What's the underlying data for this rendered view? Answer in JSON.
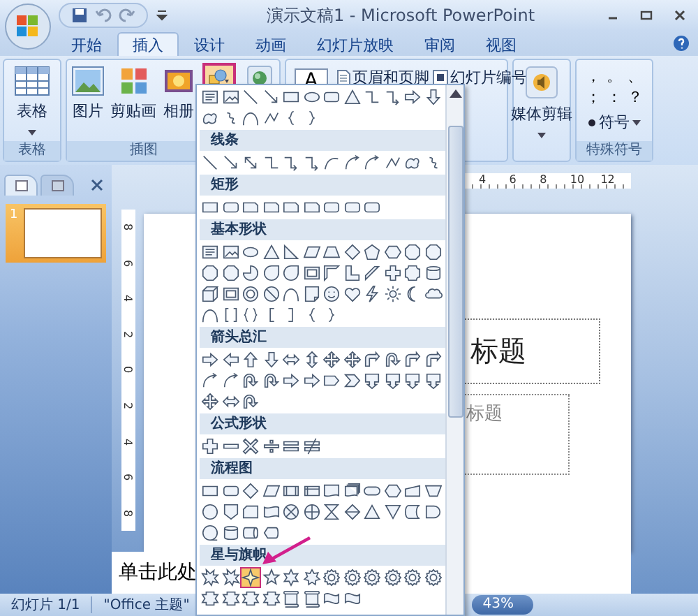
{
  "window": {
    "title": "演示文稿1 - Microsoft PowerPoint"
  },
  "tabs": [
    {
      "label": "开始",
      "selected": false
    },
    {
      "label": "插入",
      "selected": true
    },
    {
      "label": "设计",
      "selected": false
    },
    {
      "label": "动画",
      "selected": false
    },
    {
      "label": "幻灯片放映",
      "selected": false
    },
    {
      "label": "审阅",
      "selected": false
    },
    {
      "label": "视图",
      "selected": false
    }
  ],
  "ribbon": {
    "table_group": {
      "label": "表格",
      "button": "表格"
    },
    "illustrations_group": {
      "label": "插图",
      "buttons": [
        "图片",
        "剪贴画",
        "相册"
      ],
      "shapes_button": {
        "highlighted": true
      }
    },
    "text_group": {
      "text_box_glyph": "A",
      "buttons": [
        "页眉和页脚",
        "幻灯片编号"
      ]
    },
    "media_group": {
      "button": "媒体剪辑"
    },
    "symbols_group": {
      "label": "特殊符号",
      "symbols": [
        "，",
        "。",
        "、",
        "；",
        "：",
        "？"
      ],
      "symbol_button": "符号"
    }
  },
  "left_pane": {
    "tabs": [
      {
        "selected": true
      },
      {
        "selected": false
      }
    ],
    "slides": [
      {
        "number": "1",
        "selected": true
      }
    ]
  },
  "ruler": {
    "horizontal": [
      "4",
      "6",
      "8",
      "10",
      "12"
    ],
    "vertical": [
      "8",
      "6",
      "4",
      "2",
      "0",
      "2",
      "4",
      "6",
      "8"
    ]
  },
  "slide": {
    "title_placeholder": "标题",
    "subtitle_placeholder": "标题"
  },
  "notes": {
    "hint": "单击此处"
  },
  "status_bar": {
    "slide_counter": "幻灯片 1/1",
    "theme": "\"Office 主题\"",
    "zoom": "43%"
  },
  "shapes_gallery": {
    "sections": [
      {
        "shapes": [
          {
            "kind": "textbox",
            "selected": false
          },
          {
            "kind": "picture",
            "selected": false
          },
          {
            "kind": "line",
            "selected": false
          },
          {
            "kind": "arrowline",
            "selected": false
          },
          {
            "kind": "rect",
            "selected": false
          },
          {
            "kind": "oval",
            "selected": false
          },
          {
            "kind": "rrect",
            "selected": false
          },
          {
            "kind": "tri",
            "selected": false
          },
          {
            "kind": "elbow",
            "selected": false
          },
          {
            "kind": "elbowarrow",
            "selected": false
          },
          {
            "kind": "rarrow",
            "selected": false
          },
          {
            "kind": "darrow",
            "selected": false
          },
          {
            "kind": "freeform",
            "selected": false
          },
          {
            "kind": "scribble",
            "selected": false
          },
          {
            "kind": "arc",
            "selected": false
          },
          {
            "kind": "zigzag",
            "selected": false
          },
          {
            "kind": "lbrace",
            "selected": false
          },
          {
            "kind": "rbrace",
            "selected": false
          }
        ]
      },
      {
        "title": "线条",
        "shapes": [
          {
            "kind": "line",
            "selected": false
          },
          {
            "kind": "arrowline",
            "selected": false
          },
          {
            "kind": "dblarrow",
            "selected": false
          },
          {
            "kind": "elbow",
            "selected": false
          },
          {
            "kind": "elbowarrow",
            "selected": false
          },
          {
            "kind": "elbowarrow",
            "selected": false
          },
          {
            "kind": "curve",
            "selected": false
          },
          {
            "kind": "curvearrow",
            "selected": false
          },
          {
            "kind": "curvearrow",
            "selected": false
          },
          {
            "kind": "zigzag",
            "selected": false
          },
          {
            "kind": "freeform",
            "selected": false
          },
          {
            "kind": "scribble",
            "selected": false
          }
        ]
      },
      {
        "title": "矩形",
        "shapes": [
          {
            "kind": "rect",
            "selected": false
          },
          {
            "kind": "rrect",
            "selected": false
          },
          {
            "kind": "snip",
            "selected": false
          },
          {
            "kind": "snip",
            "selected": false
          },
          {
            "kind": "snip",
            "selected": false
          },
          {
            "kind": "snip",
            "selected": false
          },
          {
            "kind": "rrect",
            "selected": false
          },
          {
            "kind": "rrect",
            "selected": false
          },
          {
            "kind": "rrect",
            "selected": false
          }
        ]
      },
      {
        "title": "基本形状",
        "shapes": [
          {
            "kind": "textbox",
            "selected": false
          },
          {
            "kind": "picture",
            "selected": false
          },
          {
            "kind": "oval",
            "selected": false
          },
          {
            "kind": "tri",
            "selected": false
          },
          {
            "kind": "rtri",
            "selected": false
          },
          {
            "kind": "para",
            "selected": false
          },
          {
            "kind": "trap",
            "selected": false
          },
          {
            "kind": "diamond",
            "selected": false
          },
          {
            "kind": "pentagon",
            "selected": false
          },
          {
            "kind": "hexagon",
            "selected": false
          },
          {
            "kind": "octagon",
            "selected": false
          },
          {
            "kind": "octagon",
            "selected": false
          },
          {
            "kind": "octagon",
            "selected": false
          },
          {
            "kind": "octagon",
            "selected": false
          },
          {
            "kind": "pie",
            "selected": false
          },
          {
            "kind": "teardrop",
            "selected": false
          },
          {
            "kind": "teardrop",
            "selected": false
          },
          {
            "kind": "frame",
            "selected": false
          },
          {
            "kind": "halfframe",
            "selected": false
          },
          {
            "kind": "lshape",
            "selected": false
          },
          {
            "kind": "pencil",
            "selected": false
          },
          {
            "kind": "plus",
            "selected": false
          },
          {
            "kind": "plaque",
            "selected": false
          },
          {
            "kind": "cyl",
            "selected": false
          },
          {
            "kind": "cube",
            "selected": false
          },
          {
            "kind": "frame",
            "selected": false
          },
          {
            "kind": "donut",
            "selected": false
          },
          {
            "kind": "nosymbol",
            "selected": false
          },
          {
            "kind": "arc",
            "selected": false
          },
          {
            "kind": "fold",
            "selected": false
          },
          {
            "kind": "smile",
            "selected": false
          },
          {
            "kind": "heart",
            "selected": false
          },
          {
            "kind": "lightning",
            "selected": false
          },
          {
            "kind": "sun",
            "selected": false
          },
          {
            "kind": "moon",
            "selected": false
          },
          {
            "kind": "cloud",
            "selected": false
          },
          {
            "kind": "arc",
            "selected": false
          },
          {
            "kind": "brackets",
            "selected": false
          },
          {
            "kind": "braces",
            "selected": false
          },
          {
            "kind": "lbracket",
            "selected": false
          },
          {
            "kind": "rbracket",
            "selected": false
          },
          {
            "kind": "lbrace",
            "selected": false
          },
          {
            "kind": "rbrace",
            "selected": false
          }
        ]
      },
      {
        "title": "箭头总汇",
        "shapes": [
          {
            "kind": "rarrow",
            "selected": false
          },
          {
            "kind": "larrow",
            "selected": false
          },
          {
            "kind": "uarrow",
            "selected": false
          },
          {
            "kind": "darrow",
            "selected": false
          },
          {
            "kind": "lrarrow",
            "selected": false
          },
          {
            "kind": "udarrow",
            "selected": false
          },
          {
            "kind": "quadarrow",
            "selected": false
          },
          {
            "kind": "quadarrow",
            "selected": false
          },
          {
            "kind": "bentarrow",
            "selected": false
          },
          {
            "kind": "uturn",
            "selected": false
          },
          {
            "kind": "bentarrow",
            "selected": false
          },
          {
            "kind": "bentarrow",
            "selected": false
          },
          {
            "kind": "curvearrow",
            "selected": false
          },
          {
            "kind": "curvearrow",
            "selected": false
          },
          {
            "kind": "uturn",
            "selected": false
          },
          {
            "kind": "uturn",
            "selected": false
          },
          {
            "kind": "rarrow",
            "selected": false
          },
          {
            "kind": "rarrow",
            "selected": false
          },
          {
            "kind": "pentarrow",
            "selected": false
          },
          {
            "kind": "chevron",
            "selected": false
          },
          {
            "kind": "callout",
            "selected": false
          },
          {
            "kind": "callout",
            "selected": false
          },
          {
            "kind": "callout",
            "selected": false
          },
          {
            "kind": "callout",
            "selected": false
          },
          {
            "kind": "quadarrow",
            "selected": false
          },
          {
            "kind": "lrarrow",
            "selected": false
          },
          {
            "kind": "uturn",
            "selected": false
          }
        ]
      },
      {
        "title": "公式形状",
        "shapes": [
          {
            "kind": "plus",
            "selected": false
          },
          {
            "kind": "minus",
            "selected": false
          },
          {
            "kind": "times",
            "selected": false
          },
          {
            "kind": "divide",
            "selected": false
          },
          {
            "kind": "equal",
            "selected": false
          },
          {
            "kind": "notequal",
            "selected": false
          }
        ]
      },
      {
        "title": "流程图",
        "shapes": [
          {
            "kind": "rect",
            "selected": false
          },
          {
            "kind": "rrect",
            "selected": false
          },
          {
            "kind": "diamond",
            "selected": false
          },
          {
            "kind": "para",
            "selected": false
          },
          {
            "kind": "predefined",
            "selected": false
          },
          {
            "kind": "internal",
            "selected": false
          },
          {
            "kind": "document",
            "selected": false
          },
          {
            "kind": "multidoc",
            "selected": false
          },
          {
            "kind": "terminator",
            "selected": false
          },
          {
            "kind": "hexagon",
            "selected": false
          },
          {
            "kind": "manualinput",
            "selected": false
          },
          {
            "kind": "invtrap",
            "selected": false
          },
          {
            "kind": "circle",
            "selected": false
          },
          {
            "kind": "offpage",
            "selected": false
          },
          {
            "kind": "card",
            "selected": false
          },
          {
            "kind": "punchedtape",
            "selected": false
          },
          {
            "kind": "summing",
            "selected": false
          },
          {
            "kind": "orflow",
            "selected": false
          },
          {
            "kind": "collate",
            "selected": false
          },
          {
            "kind": "sort",
            "selected": false
          },
          {
            "kind": "tri",
            "selected": false
          },
          {
            "kind": "merge",
            "selected": false
          },
          {
            "kind": "storeddata",
            "selected": false
          },
          {
            "kind": "delay",
            "selected": false
          },
          {
            "kind": "seqstorage",
            "selected": false
          },
          {
            "kind": "cyl",
            "selected": false
          },
          {
            "kind": "directaccess",
            "selected": false
          },
          {
            "kind": "display",
            "selected": false
          }
        ]
      },
      {
        "title": "星与旗帜",
        "shapes": [
          {
            "kind": "burst",
            "selected": false
          },
          {
            "kind": "burst",
            "selected": false
          },
          {
            "kind": "star4",
            "selected": true
          },
          {
            "kind": "star5",
            "selected": false
          },
          {
            "kind": "star6",
            "selected": false
          },
          {
            "kind": "star7",
            "selected": false
          },
          {
            "kind": "seal",
            "selected": false
          },
          {
            "kind": "seal",
            "selected": false
          },
          {
            "kind": "seal",
            "selected": false
          },
          {
            "kind": "seal",
            "selected": false
          },
          {
            "kind": "seal",
            "selected": false
          },
          {
            "kind": "seal",
            "selected": false
          },
          {
            "kind": "ribbon",
            "selected": false
          },
          {
            "kind": "ribbon",
            "selected": false
          },
          {
            "kind": "ribbon",
            "selected": false
          },
          {
            "kind": "ribbon",
            "selected": false
          },
          {
            "kind": "scroll",
            "selected": false
          },
          {
            "kind": "scroll",
            "selected": false
          },
          {
            "kind": "wave",
            "selected": false
          },
          {
            "kind": "wave",
            "selected": false
          }
        ]
      }
    ]
  }
}
